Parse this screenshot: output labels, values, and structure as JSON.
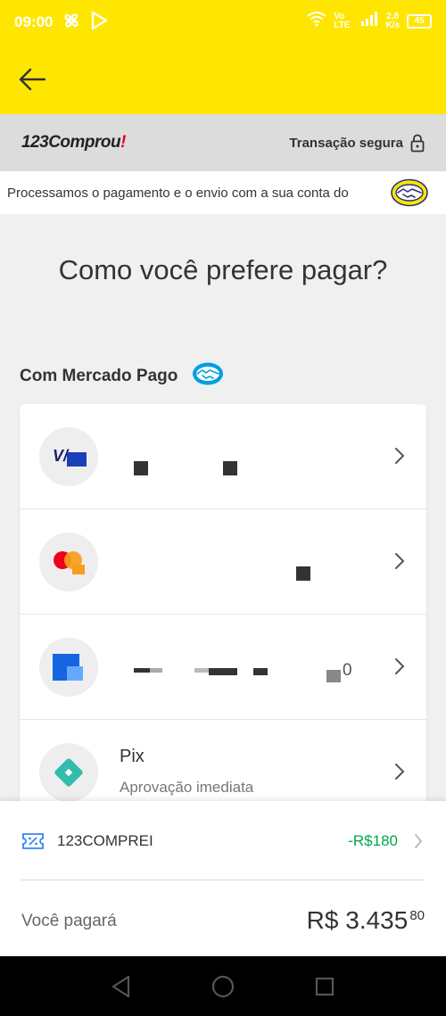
{
  "status_bar": {
    "time": "09:00",
    "network_label": "Vo LTE",
    "speed_value": "2,8",
    "speed_unit": "K/s",
    "battery": "45"
  },
  "store": {
    "logo_num": "123",
    "logo_text": "Comprou",
    "logo_bang": "!",
    "secure_label": "Transação segura"
  },
  "info_bar": {
    "text": "Processamos o pagamento e o envio com a sua conta do"
  },
  "page": {
    "title": "Como você prefere pagar?"
  },
  "section": {
    "title": "Com Mercado Pago"
  },
  "methods": [
    {
      "icon": "visa-card-icon",
      "name": "",
      "sub": ""
    },
    {
      "icon": "mastercard-icon",
      "name": "",
      "sub": ""
    },
    {
      "icon": "card-icon",
      "name": "",
      "sub": "",
      "partial_text": "0"
    },
    {
      "icon": "pix-icon",
      "name": "Pix",
      "sub": "Aprovação imediata"
    }
  ],
  "coupon": {
    "name": "123COMPREI",
    "discount": "-R$180"
  },
  "summary": {
    "label": "Você pagará",
    "total": "R$ 3.435",
    "cents": "80"
  },
  "colors": {
    "brand_yellow": "#ffe600",
    "discount_green": "#00a650",
    "mp_blue": "#009ee3"
  }
}
